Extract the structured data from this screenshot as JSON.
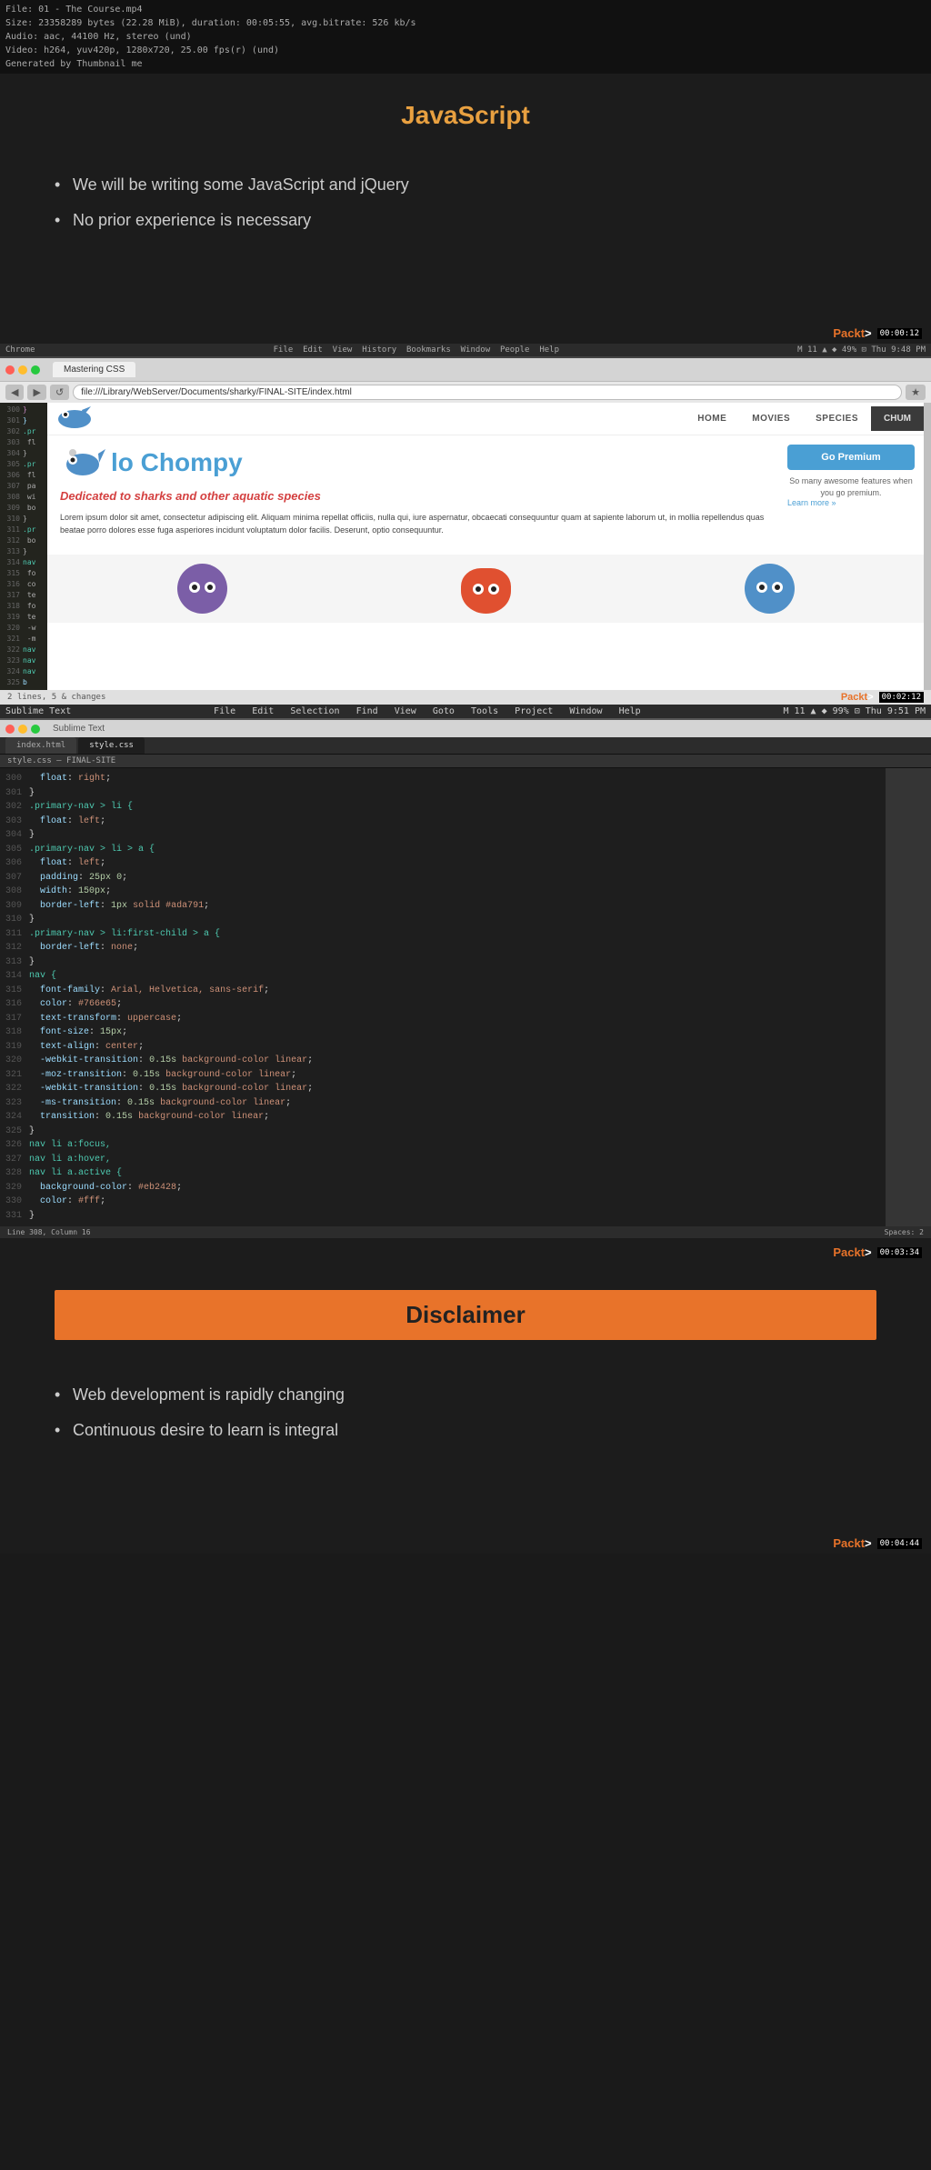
{
  "fileInfo": {
    "line1": "File: 01 - The Course.mp4",
    "line2": "Size: 23358289 bytes (22.28 MiB), duration: 00:05:55, avg.bitrate: 526 kb/s",
    "line3": "Audio: aac, 44100 Hz, stereo (und)",
    "line4": "Video: h264, yuv420p, 1280x720, 25.00 fps(r) (und)",
    "line5": "Generated by Thumbnail me"
  },
  "slide1": {
    "title": "JavaScript",
    "bullets": [
      "We will be writing some JavaScript and jQuery",
      "No prior experience is necessary"
    ],
    "timestamp": "00:00:12"
  },
  "browser": {
    "tab_label": "Mastering CSS",
    "url": "file:///Library/WebServer/Documents/sharky/FINAL-SITE/index.html",
    "app_label": "Chrome",
    "menu_items": [
      "File",
      "Edit",
      "View",
      "History",
      "Bookmarks",
      "Window",
      "People",
      "Help"
    ],
    "timestamp": "00:02:12",
    "clock": "Thu 9:48 PM",
    "nav_items": [
      "HOME",
      "MOVIES",
      "SPECIES",
      "CHUM"
    ],
    "brand_name": "lo Chompy",
    "tagline": "Dedicated to sharks and other aquatic species",
    "body_text": "Lorem ipsum dolor sit amet, consectetur adipiscing elit. Aliquam minima repellat officiis, nulla qui, iure aspernatur, obcaecati consequuntur quam at sapiente laborum ut, in mollia repellendus quas beatae porro dolores esse fuga asperiores incidunt voluptatum dolor facilis. Deserunt, optio consequuntur.",
    "premium_btn": "Go Premium",
    "premium_sub": "So many awesome features when you go premium.",
    "premium_link": "Learn more »",
    "status_bar": "2 lines, 5 & changes",
    "scrollbar_note": ""
  },
  "sublime": {
    "app_label": "Sublime Text",
    "menu_items": [
      "File",
      "Edit",
      "Selection",
      "Find",
      "View",
      "Goto",
      "Tools",
      "Project",
      "Window",
      "Help"
    ],
    "tab1": "index.html",
    "tab2": "style.css",
    "tab_active": "style.css",
    "breadcrumb": "style.css — FINAL-SITE",
    "timestamp": "00:03:34",
    "clock": "Thu 9:51 PM",
    "status_bar_left": "Line 308, Column 16",
    "status_bar_right": "Spaces: 2",
    "code_lines": [
      {
        "num": "300",
        "text": "  float: right;"
      },
      {
        "num": "301",
        "text": "}"
      },
      {
        "num": "302",
        "text": ".primary-nav > li {"
      },
      {
        "num": "303",
        "text": "  float: left;"
      },
      {
        "num": "304",
        "text": "}"
      },
      {
        "num": "305",
        "text": ".primary-nav > li > a {"
      },
      {
        "num": "306",
        "text": "  float: left;"
      },
      {
        "num": "307",
        "text": "  padding: 25px 0;"
      },
      {
        "num": "308",
        "text": "  width: 150px;"
      },
      {
        "num": "309",
        "text": "  border-left: 1px solid #ada791;"
      },
      {
        "num": "310",
        "text": "}"
      },
      {
        "num": "311",
        "text": ".primary-nav > li:first-child > a {"
      },
      {
        "num": "312",
        "text": "  border-left: none;"
      },
      {
        "num": "313",
        "text": "}"
      },
      {
        "num": "314",
        "text": "nav {"
      },
      {
        "num": "315",
        "text": "  font-family: Arial, Helvetica, sans-serif;"
      },
      {
        "num": "316",
        "text": "  color: #766e65;"
      },
      {
        "num": "317",
        "text": "  text-transform: uppercase;"
      },
      {
        "num": "318",
        "text": "  font-size: 15px;"
      },
      {
        "num": "319",
        "text": "  text-align: center;"
      },
      {
        "num": "320",
        "text": "  -webkit-transition: 0.15s background-color linear;"
      },
      {
        "num": "321",
        "text": "  -moz-transition: 0.15s background-color linear;"
      },
      {
        "num": "322",
        "text": "  -webkit-transition: 0.15s background-color linear;"
      },
      {
        "num": "323",
        "text": "  -ms-transition: 0.15s background-color linear;"
      },
      {
        "num": "324",
        "text": "  transition: 0.15s background-color linear;"
      },
      {
        "num": "325",
        "text": "}"
      },
      {
        "num": "326",
        "text": "nav li a:focus,"
      },
      {
        "num": "327",
        "text": "nav li a:hover,"
      },
      {
        "num": "328",
        "text": "nav li a.active {"
      },
      {
        "num": "329",
        "text": "  background-color: #eb2428;"
      },
      {
        "num": "330",
        "text": "  color: #fff;"
      },
      {
        "num": "331",
        "text": "}"
      }
    ]
  },
  "slide2": {
    "title": "Disclaimer",
    "bullets": [
      "Web development is rapidly changing",
      "Continuous desire to learn is integral"
    ],
    "timestamp": "00:04:44"
  },
  "packt": {
    "brand": "Packt",
    "plus": ">"
  }
}
